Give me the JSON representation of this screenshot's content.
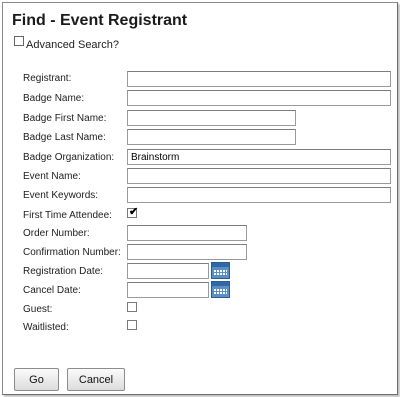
{
  "title": "Find - Event Registrant",
  "advanced_search": {
    "label": "Advanced Search?",
    "checked": false
  },
  "fields": {
    "registrant": {
      "label": "Registrant:",
      "value": ""
    },
    "badge_name": {
      "label": "Badge Name:",
      "value": ""
    },
    "badge_first_name": {
      "label": "Badge First Name:",
      "value": ""
    },
    "badge_last_name": {
      "label": "Badge Last Name:",
      "value": ""
    },
    "badge_organization": {
      "label": "Badge Organization:",
      "value": "Brainstorm"
    },
    "event_name": {
      "label": "Event Name:",
      "value": ""
    },
    "event_keywords": {
      "label": "Event Keywords:",
      "value": ""
    },
    "first_time_attendee": {
      "label": "First Time Attendee:",
      "checked": true
    },
    "order_number": {
      "label": "Order Number:",
      "value": ""
    },
    "confirmation_number": {
      "label": "Confirmation Number:",
      "value": ""
    },
    "registration_date": {
      "label": "Registration Date:",
      "value": "",
      "icon": "calendar-icon"
    },
    "cancel_date": {
      "label": "Cancel Date:",
      "value": "",
      "icon": "calendar-icon"
    },
    "guest": {
      "label": "Guest:",
      "checked": false
    },
    "waitlisted": {
      "label": "Waitlisted:",
      "checked": false
    }
  },
  "buttons": {
    "go": "Go",
    "cancel": "Cancel"
  },
  "colors": {
    "calendar_blue": "#5b8fc4",
    "border_gray": "#8a8a8a"
  }
}
